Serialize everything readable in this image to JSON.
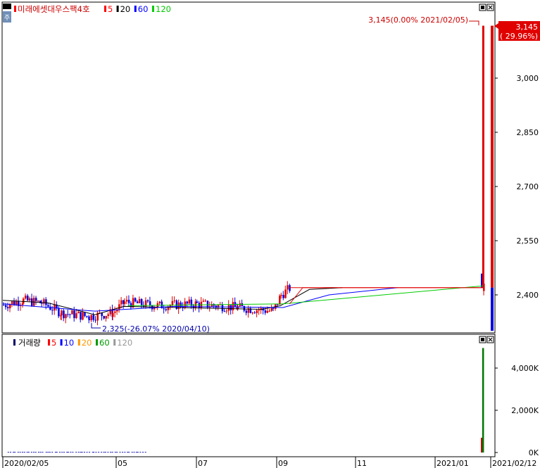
{
  "chart_data": [
    {
      "type": "candlestick",
      "title": "미래에셋대우스팩4호",
      "legend": [
        {
          "label": "5",
          "color": "#ff0000"
        },
        {
          "label": "20",
          "color": "#000000"
        },
        {
          "label": "60",
          "color": "#0000ff"
        },
        {
          "label": "120",
          "color": "#00cc00"
        }
      ],
      "y_ticks": [
        "3,000",
        "2,850",
        "2,700",
        "2,550",
        "2,400"
      ],
      "ylim": [
        2300,
        3250
      ],
      "last_price_label": "3,145",
      "last_change_label": "( 29.96%)",
      "annotation_high": "3,145(0.00% 2021/02/05)",
      "annotation_low": "2,325(-26.07% 2020/04/10)",
      "series_close": [
        {
          "x": "2020/02/05",
          "y": 2372
        },
        {
          "x": "2020/02/20",
          "y": 2385
        },
        {
          "x": "2020/03/05",
          "y": 2378
        },
        {
          "x": "2020/03/20",
          "y": 2350
        },
        {
          "x": "2020/04/10",
          "y": 2340
        },
        {
          "x": "2020/04/28",
          "y": 2350
        },
        {
          "x": "2020/05/07",
          "y": 2380
        },
        {
          "x": "2020/06/01",
          "y": 2370
        },
        {
          "x": "2020/07/01",
          "y": 2375
        },
        {
          "x": "2020/08/01",
          "y": 2365
        },
        {
          "x": "2020/08/28",
          "y": 2355
        },
        {
          "x": "2020/09/03",
          "y": 2400
        },
        {
          "x": "2020/09/10",
          "y": 2420
        },
        {
          "x": "2021/02/04",
          "y": 2420
        },
        {
          "x": "2021/02/05",
          "y": 3145
        }
      ]
    },
    {
      "type": "bar",
      "title": "거래량",
      "legend": [
        {
          "label": "5",
          "color": "#ff0000"
        },
        {
          "label": "10",
          "color": "#0000ff"
        },
        {
          "label": "20",
          "color": "#ff9900"
        },
        {
          "label": "60",
          "color": "#009900"
        },
        {
          "label": "120",
          "color": "#999999"
        }
      ],
      "y_ticks": [
        "4,000K",
        "2,000K",
        "0K"
      ],
      "ylim": [
        0,
        5000
      ],
      "volume": [
        {
          "x": "2021/02/04",
          "y": 700
        },
        {
          "x": "2021/02/05",
          "y": 4950
        }
      ]
    }
  ],
  "x_axis_labels": [
    "2020/02/05",
    "05",
    "07",
    "09",
    "11",
    "2021/01",
    "2021/02/12"
  ]
}
